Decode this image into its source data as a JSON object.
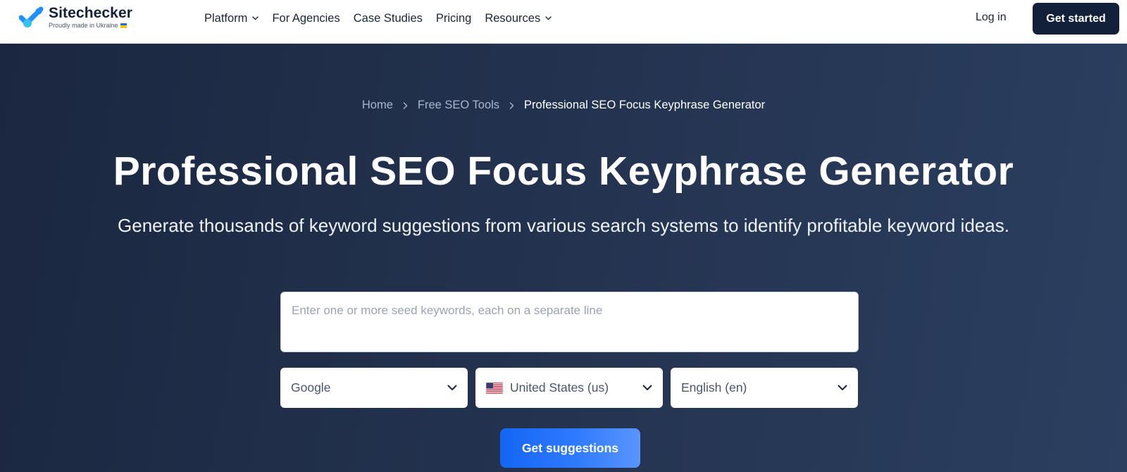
{
  "header": {
    "logo": {
      "name": "Sitechecker",
      "tagline": "Proudly made in Ukraine"
    },
    "nav": [
      {
        "label": "Platform",
        "has_dropdown": true
      },
      {
        "label": "For Agencies",
        "has_dropdown": false
      },
      {
        "label": "Case Studies",
        "has_dropdown": false
      },
      {
        "label": "Pricing",
        "has_dropdown": false
      },
      {
        "label": "Resources",
        "has_dropdown": true
      }
    ],
    "login_label": "Log in",
    "cta_label": "Get started"
  },
  "hero": {
    "breadcrumb": [
      {
        "label": "Home"
      },
      {
        "label": "Free SEO Tools"
      },
      {
        "label": "Professional SEO Focus Keyphrase Generator"
      }
    ],
    "title": "Professional SEO Focus Keyphrase Generator",
    "subtitle": "Generate thousands of keyword suggestions from various search systems to identify profitable keyword ideas.",
    "keywords_input": {
      "value": "",
      "placeholder": "Enter one or more seed keywords, each on a separate line"
    },
    "selects": {
      "search_engine": {
        "value": "Google",
        "icon": "chevron-down-icon"
      },
      "country": {
        "value": "United States (us)",
        "icon": "us-flag-icon"
      },
      "language": {
        "value": "English (en)",
        "icon": "chevron-down-icon"
      }
    },
    "submit_label": "Get suggestions"
  },
  "colors": {
    "navy": "#13203a",
    "hero_bg_start": "#1b2740",
    "hero_bg_end": "#2c3f60",
    "accent_blue": "#1565f5",
    "logo_blue": "#1e90ff",
    "logo_cyan": "#33c1f0"
  }
}
